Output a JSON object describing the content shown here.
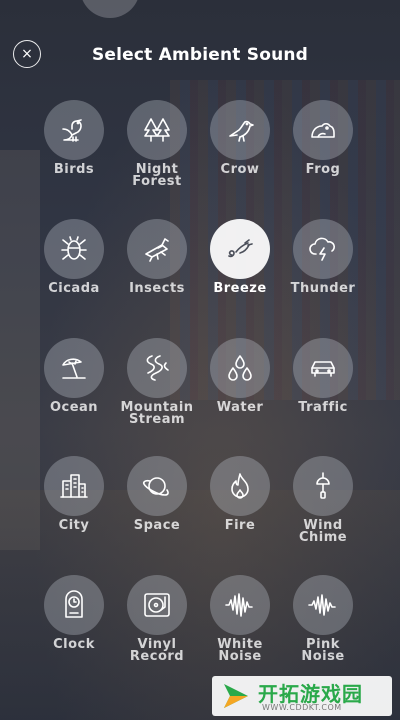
{
  "header": {
    "title": "Select Ambient Sound",
    "close_label": "×"
  },
  "sounds": [
    {
      "label": "Birds",
      "icon": "bird-icon"
    },
    {
      "label": "Night\nForest",
      "icon": "forest-icon"
    },
    {
      "label": "Crow",
      "icon": "crow-icon"
    },
    {
      "label": "Frog",
      "icon": "frog-icon"
    },
    {
      "label": "Cicada",
      "icon": "cicada-icon"
    },
    {
      "label": "Insects",
      "icon": "insect-icon"
    },
    {
      "label": "Breeze",
      "icon": "breeze-icon",
      "selected": true
    },
    {
      "label": "Thunder",
      "icon": "thunder-icon"
    },
    {
      "label": "Ocean",
      "icon": "beach-umbrella-icon"
    },
    {
      "label": "Mountain\nStream",
      "icon": "stream-icon"
    },
    {
      "label": "Water",
      "icon": "water-drops-icon"
    },
    {
      "label": "Traffic",
      "icon": "car-icon"
    },
    {
      "label": "City",
      "icon": "buildings-icon"
    },
    {
      "label": "Space",
      "icon": "planet-icon"
    },
    {
      "label": "Fire",
      "icon": "flame-icon"
    },
    {
      "label": "Wind\nChime",
      "icon": "wind-chime-icon"
    },
    {
      "label": "Clock",
      "icon": "clock-icon"
    },
    {
      "label": "Vinyl\nRecord",
      "icon": "turntable-icon"
    },
    {
      "label": "White\nNoise",
      "icon": "waveform-icon"
    },
    {
      "label": "Pink\nNoise",
      "icon": "waveform-icon"
    }
  ],
  "watermark": {
    "text": "开拓游戏园",
    "url": "WWW.CDDKT.COM"
  },
  "colors": {
    "selected_circle": "#ffffff",
    "circle": "#bec3cd",
    "brand_green": "#2aa94a"
  }
}
